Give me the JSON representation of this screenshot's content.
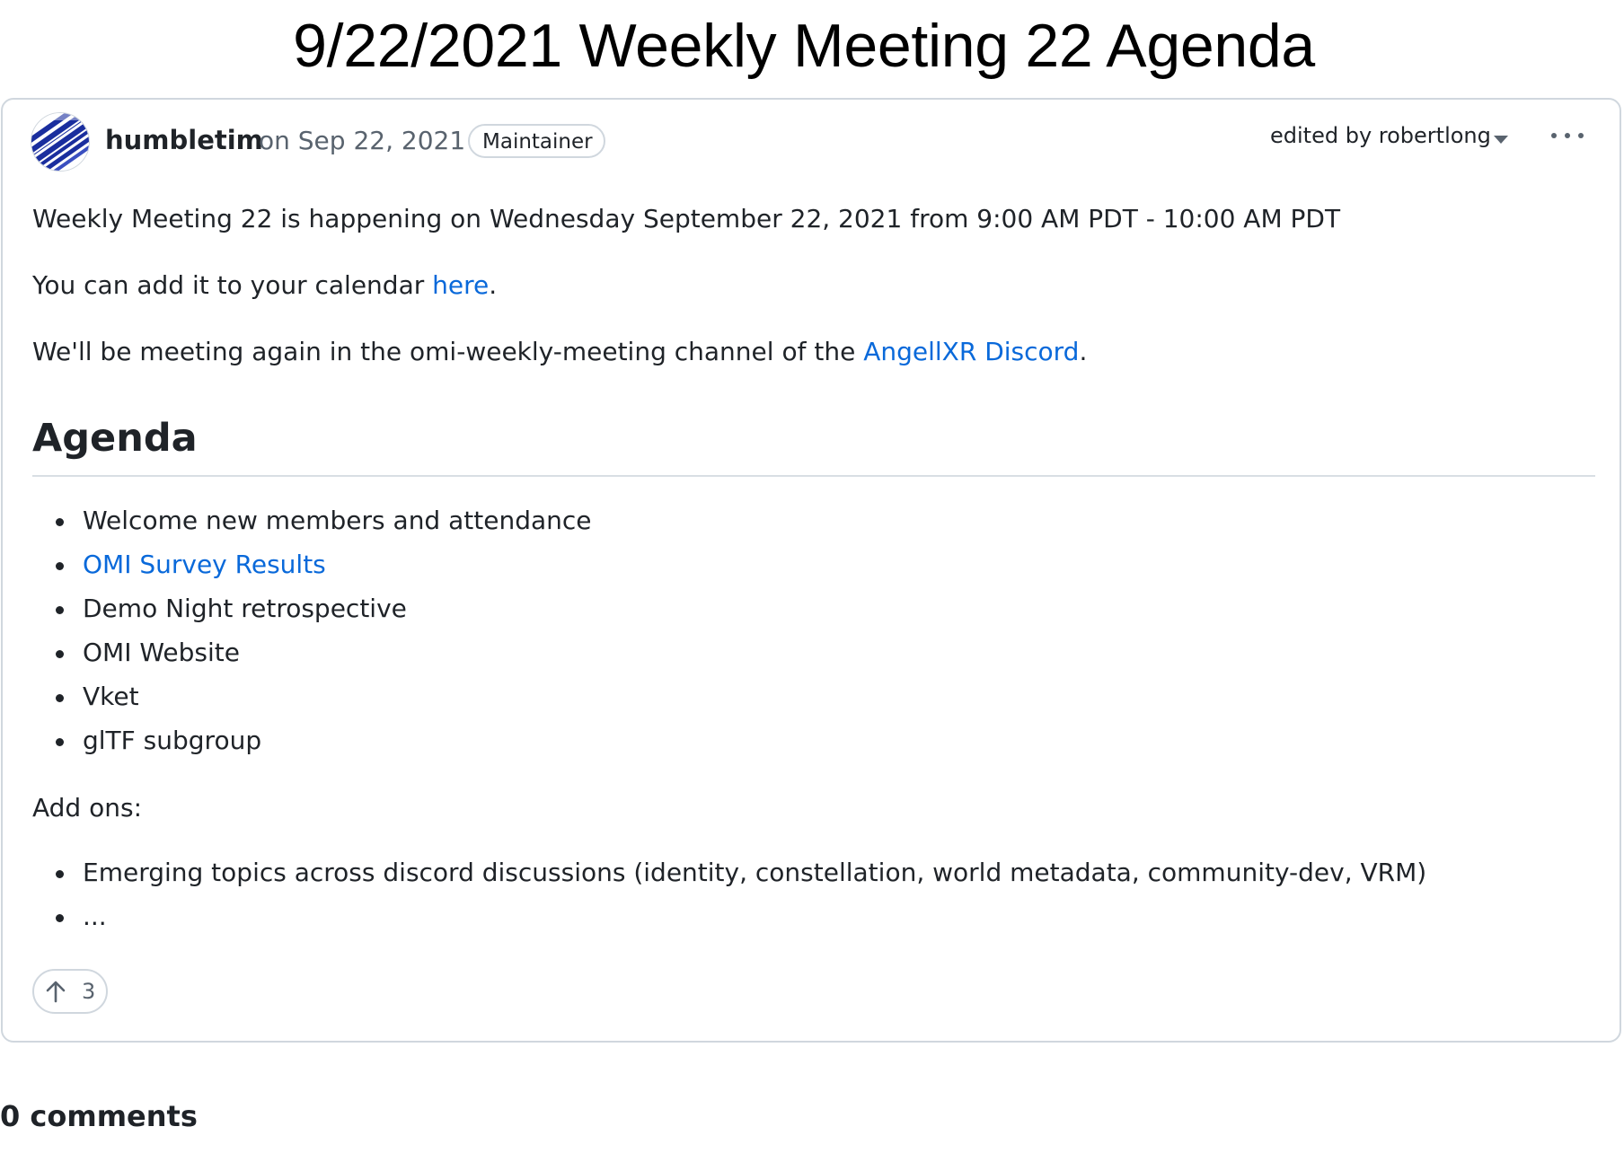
{
  "page_title": "9/22/2021 Weekly Meeting 22 Agenda",
  "post": {
    "author": "humbletim",
    "date": "on Sep 22, 2021",
    "badge": "Maintainer",
    "edited_by": "edited by robertlong",
    "intro": {
      "line1": "Weekly Meeting 22 is happening on Wednesday September 22, 2021 from 9:00 AM PDT - 10:00 AM PDT",
      "line2_prefix": "You can add it to your calendar ",
      "line2_link": "here",
      "line2_suffix": ".",
      "line3_prefix": "We'll be meeting again in the omi-weekly-meeting channel of the ",
      "line3_link": "AngellXR Discord",
      "line3_suffix": "."
    },
    "agenda_heading": "Agenda",
    "agenda_items": [
      "Welcome new members and attendance",
      "OMI Survey Results",
      "Demo Night retrospective",
      "OMI Website",
      "Vket",
      "glTF subgroup"
    ],
    "addons_label": "Add ons:",
    "addons_items": [
      "Emerging topics across discord discussions (identity, constellation, world metadata, community-dev, VRM)",
      "..."
    ],
    "upvote_count": "3"
  },
  "comments_heading": "0 comments",
  "colors": {
    "link": "#0969da",
    "text": "#1f2328",
    "muted": "#59636e",
    "border": "#d0d7de",
    "avatar_blue": "#1a2e9e"
  },
  "icons": [
    "avatar-image",
    "chevron-down-icon",
    "kebab-menu-icon",
    "arrow-up-icon"
  ]
}
